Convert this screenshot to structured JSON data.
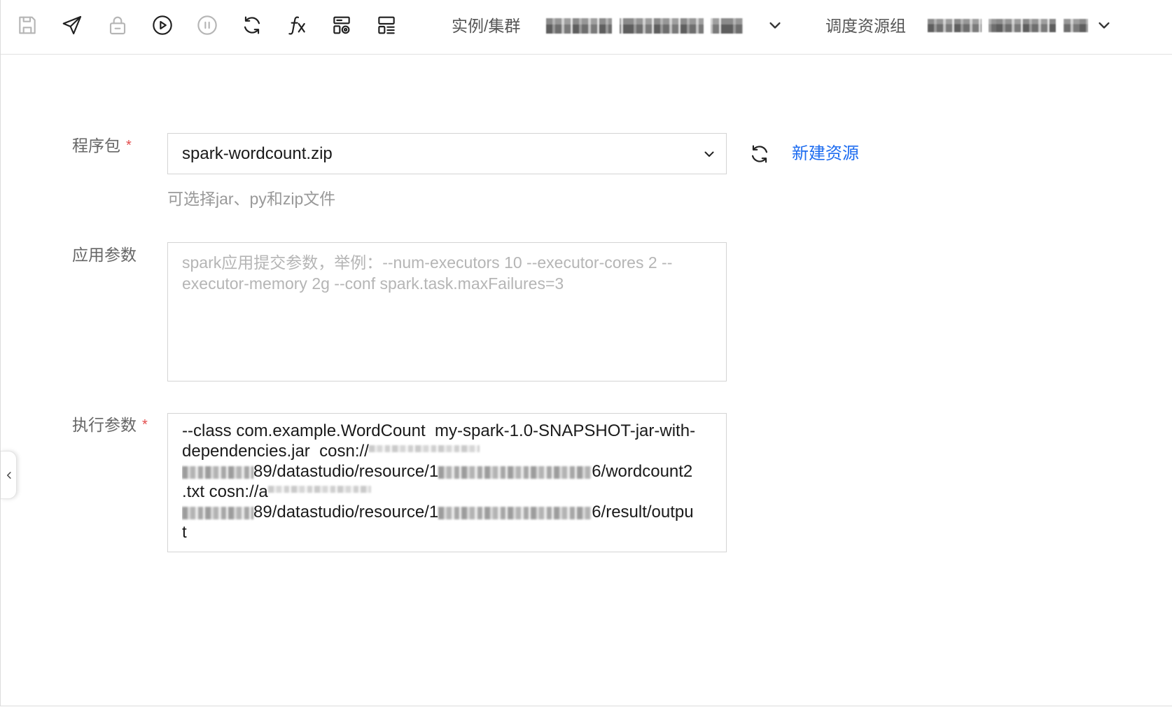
{
  "toolbar": {
    "icons": [
      "save-icon",
      "send-icon",
      "lock-icon",
      "play-icon",
      "pause-icon",
      "refresh-icon",
      "fx-icon",
      "config-icon",
      "layout-icon"
    ],
    "disabled_icons": [
      "save-icon",
      "lock-icon",
      "pause-icon"
    ],
    "instance_label": "实例/集群",
    "resource_group_label": "调度资源组",
    "instance_value_redacted": true,
    "resource_group_value_redacted": true
  },
  "form": {
    "package": {
      "label": "程序包",
      "required_mark": "*",
      "value": "spark-wordcount.zip",
      "hint": "可选择jar、py和zip文件",
      "new_resource_link": "新建资源"
    },
    "app_params": {
      "label": "应用参数",
      "placeholder": "spark应用提交参数，举例：--num-executors 10 --executor-cores 2 --executor-memory 2g --conf spark.task.maxFailures=3"
    },
    "exec_params": {
      "label": "执行参数",
      "required_mark": "*",
      "lines": [
        [
          "--class com.example.WordCount  my-spark-1.0-SNAPSHOT-jar-with-"
        ],
        [
          "dependencies.jar  cosn://"
        ],
        [
          "89/datastudio/resource/1",
          "6/wordcount2"
        ],
        [
          ".txt cosn://a"
        ],
        [
          "89/datastudio/resource/1",
          "6/result/outpu"
        ],
        [
          "t"
        ]
      ]
    }
  },
  "colors": {
    "link": "#1d6cf0",
    "required": "#e34d4d",
    "label": "#666666",
    "hint": "#999999",
    "text": "#1a1a1a",
    "icon_enabled": "#1f1f1f",
    "icon_disabled": "#b5b5b5"
  }
}
